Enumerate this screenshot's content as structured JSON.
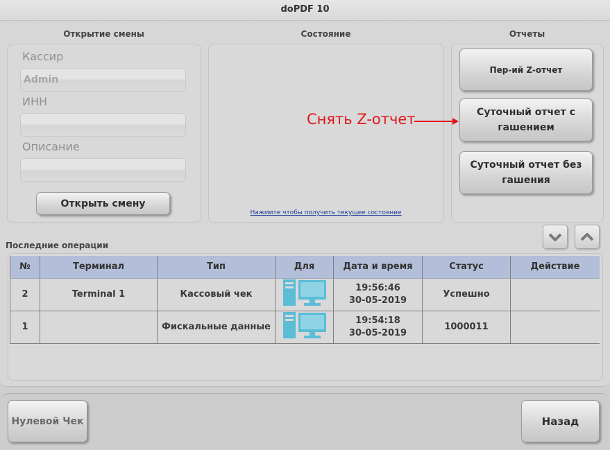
{
  "window": {
    "title": "doPDF 10"
  },
  "open_shift": {
    "title": "Открытие смены",
    "cashier_label": "Кассир",
    "cashier_value": "Admin",
    "inn_label": "ИНН",
    "inn_value": "",
    "description_label": "Описание",
    "description_value": "",
    "open_button": "Открыть смену"
  },
  "state": {
    "title": "Состояние",
    "link": "Нажмите чтобы получить текущее состояние"
  },
  "reports": {
    "title": "Отчеты",
    "buttons": [
      {
        "label": "Пер-ий Z-отчет"
      },
      {
        "label": "Суточный отчет с гашением"
      },
      {
        "label": "Суточный отчет без гашения"
      }
    ]
  },
  "annotation": {
    "text": "Снять Z-отчет",
    "color": "#e0171a"
  },
  "operations": {
    "title": "Последние операции",
    "columns": [
      "№",
      "Терминал",
      "Тип",
      "Для",
      "Дата и время",
      "Статус",
      "Действие"
    ],
    "rows": [
      {
        "num": "2",
        "terminal": "Terminal 1",
        "type": "Кассовый чек",
        "for_icon": "computers-icon",
        "date": "19:56:46",
        "time_date": "30-05-2019",
        "status": "Успешно",
        "action": ""
      },
      {
        "num": "1",
        "terminal": "",
        "type": "Фискальные данные",
        "for_icon": "computers-icon",
        "date": "19:54:18",
        "time_date": "30-05-2019",
        "status": "1000011",
        "action": ""
      }
    ]
  },
  "footer": {
    "zero_check_button": "Нулевой Чек",
    "back_button": "Назад"
  },
  "colors": {
    "header_bg": "#b3bed8",
    "icon": "#5bbcd6",
    "link": "#1c3e9c"
  }
}
